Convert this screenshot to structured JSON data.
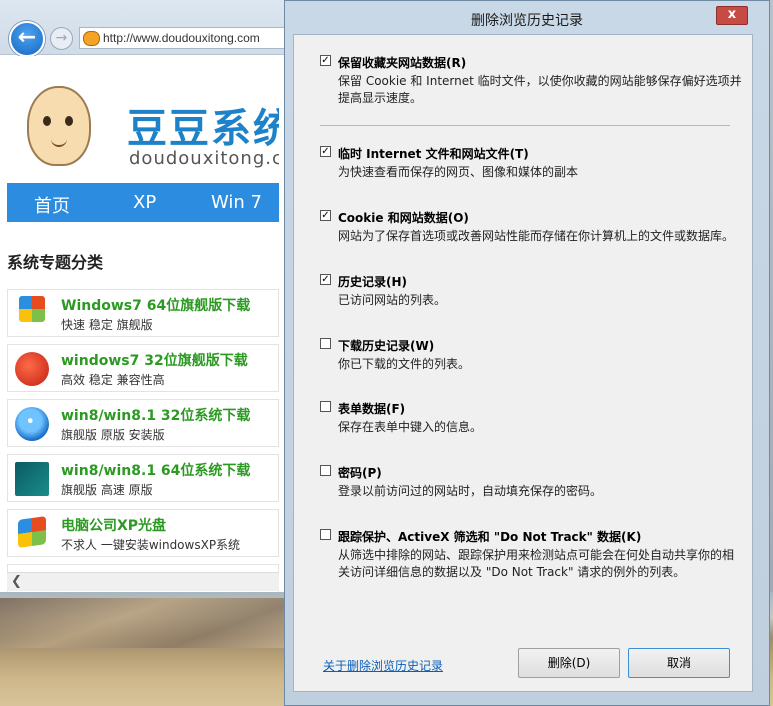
{
  "browser": {
    "url": "http://www.doudouxitong.com",
    "logo_cn": "豆豆系统",
    "logo_en": "doudouxitong.com",
    "nav": [
      "首页",
      "XP",
      "Win 7"
    ],
    "section_title": "系统专题分类",
    "list": [
      {
        "title": "Windows7 64位旗舰版下载",
        "sub": "快速 稳定 旗舰版",
        "icon": "windows7-logo-icon"
      },
      {
        "title": "windows7 32位旗舰版下载",
        "sub": "高效 稳定 兼容性高",
        "icon": "tomato-icon"
      },
      {
        "title": "win8/win8.1 32位系统下载",
        "sub": "旗舰版 原版 安装版",
        "icon": "windows-orb-icon"
      },
      {
        "title": "win8/win8.1 64位系统下载",
        "sub": "旗舰版 高速 原版",
        "icon": "win8-start-icon"
      },
      {
        "title": "电脑公司XP光盘",
        "sub": "不求人 一键安装windowsXP系统",
        "icon": "windows-xp-flag-icon"
      }
    ]
  },
  "dialog": {
    "title": "删除浏览历史记录",
    "close_label": "x",
    "options": [
      {
        "label": "保留收藏夹网站数据(R)",
        "checked": true,
        "desc": "保留 Cookie 和 Internet 临时文件，以使你收藏的网站能够保存偏好选项并提高显示速度。"
      },
      {
        "label": "临时 Internet 文件和网站文件(T)",
        "checked": true,
        "desc": "为快速查看而保存的网页、图像和媒体的副本"
      },
      {
        "label": "Cookie 和网站数据(O)",
        "checked": true,
        "desc": "网站为了保存首选项或改善网站性能而存储在你计算机上的文件或数据库。"
      },
      {
        "label": "历史记录(H)",
        "checked": true,
        "desc": "已访问网站的列表。"
      },
      {
        "label": "下载历史记录(W)",
        "checked": false,
        "desc": "你已下载的文件的列表。"
      },
      {
        "label": "表单数据(F)",
        "checked": false,
        "desc": "保存在表单中键入的信息。"
      },
      {
        "label": "密码(P)",
        "checked": false,
        "desc": "登录以前访问过的网站时，自动填充保存的密码。"
      },
      {
        "label": "跟踪保护、ActiveX 筛选和 \"Do Not Track\" 数据(K)",
        "checked": false,
        "desc": "从筛选中排除的网站、跟踪保护用来检测站点可能会在何处自动共享你的相关访问详细信息的数据以及 \"Do Not Track\" 请求的例外的列表。"
      }
    ],
    "about_link": "关于删除浏览历史记录",
    "delete_label": "删除(D)",
    "cancel_label": "取消"
  },
  "colors": {
    "accent": "#2b8ce0",
    "list_title": "#2c9a22",
    "link": "#0a5fb8",
    "close": "#c64b45"
  }
}
